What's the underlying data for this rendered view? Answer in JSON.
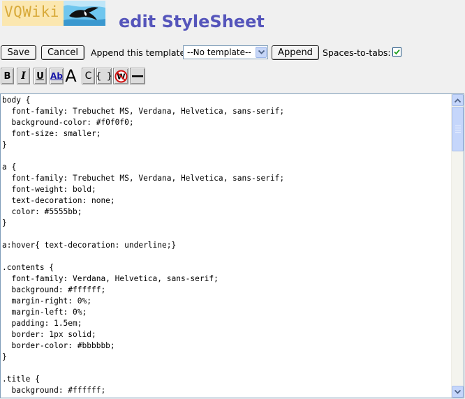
{
  "logo": {
    "text": "VQWiki"
  },
  "page": {
    "title": "edit StyleSheet"
  },
  "toolbar": {
    "save_label": "Save",
    "cancel_label": "Cancel",
    "append_template_label": "Append this template:",
    "template_selected": "--No template--",
    "append_label": "Append",
    "spaces_to_tabs_label": "Spaces-to-tabs:",
    "spaces_to_tabs_checked": true
  },
  "format_toolbar": {
    "buttons": [
      {
        "name": "bold",
        "glyph": "B"
      },
      {
        "name": "italic",
        "glyph": "I"
      },
      {
        "name": "underline",
        "glyph": "U"
      },
      {
        "name": "link",
        "glyph": "Ab"
      },
      {
        "name": "heading",
        "glyph": "A"
      },
      {
        "name": "center",
        "glyph": "C"
      },
      {
        "name": "braces",
        "glyph": "{ }"
      },
      {
        "name": "no-wiki",
        "glyph": "W"
      },
      {
        "name": "horizontal-rule",
        "glyph": ""
      }
    ]
  },
  "editor": {
    "content": "body {\n  font-family: Trebuchet MS, Verdana, Helvetica, sans-serif;\n  background-color: #f0f0f0;\n  font-size: smaller;\n}\n\na {\n  font-family: Trebuchet MS, Verdana, Helvetica, sans-serif;\n  font-weight: bold;\n  text-decoration: none;\n  color: #5555bb;\n}\n\na:hover{ text-decoration: underline;}\n\n.contents {\n  font-family: Verdana, Helvetica, sans-serif;\n  background: #ffffff;\n  margin-right: 0%;\n  margin-left: 0%;\n  padding: 1.5em;\n  border: 1px solid;\n  border-color: #bbbbbb;\n}\n\n.title {\n  background: #ffffff;"
  },
  "colors": {
    "title": "#5555bb",
    "page_background": "#f0f0f0",
    "logo_background": "#fbe7b0",
    "logo_text": "#d8aa3a"
  }
}
